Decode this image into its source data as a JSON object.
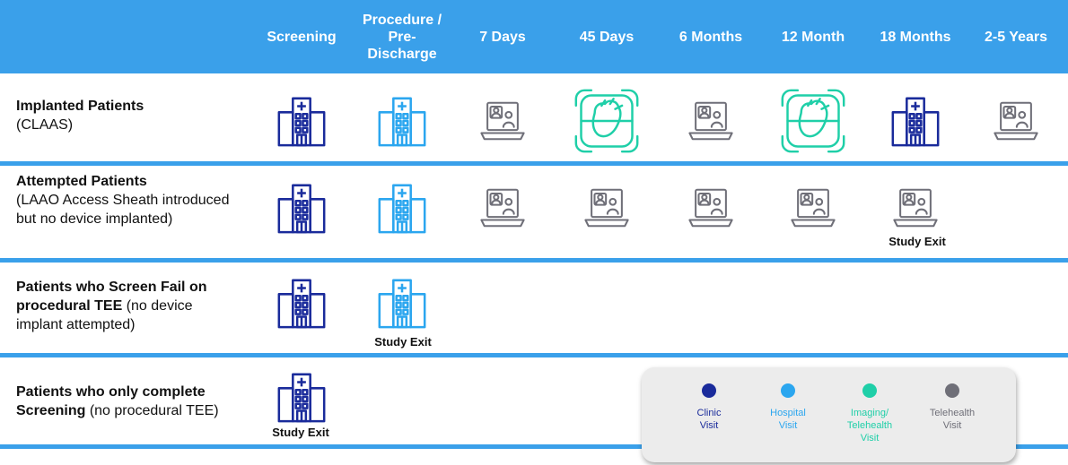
{
  "columns": [
    {
      "label": "Screening"
    },
    {
      "label": "Procedure /\nPre-\nDischarge"
    },
    {
      "label": "7 Days"
    },
    {
      "label": "45 Days"
    },
    {
      "label": "6 Months"
    },
    {
      "label": "12 Month"
    },
    {
      "label": "18 Months"
    },
    {
      "label": "2-5 Years"
    }
  ],
  "rows": [
    {
      "title": "Implanted Patients",
      "detail": "(CLAAS)",
      "visits": [
        "clinic",
        "hospital",
        "telehealth",
        "imaging",
        "telehealth",
        "imaging",
        "clinic",
        "telehealth"
      ]
    },
    {
      "title": "Attempted Patients",
      "detail": "(LAAO Access Sheath introduced but no device implanted)",
      "visits": [
        "clinic",
        "hospital",
        "telehealth",
        "telehealth",
        "telehealth",
        "telehealth",
        "telehealth",
        ""
      ]
    },
    {
      "title": "Patients who Screen Fail on procedural TEE",
      "detail": "(no device implant attempted)",
      "visits": [
        "clinic",
        "hospital",
        "",
        "",
        "",
        "",
        "",
        ""
      ]
    },
    {
      "title": "Patients who only complete Screening",
      "detail": "(no procedural TEE)",
      "visits": [
        "clinic",
        "",
        "",
        "",
        "",
        "",
        "",
        ""
      ]
    }
  ],
  "study_exit": "Study Exit",
  "legend": {
    "clinic": {
      "label": "Clinic Visit",
      "color": "#1a2b9b"
    },
    "hospital": {
      "label": "Hospital Visit",
      "color": "#2ba6ef"
    },
    "imaging": {
      "label": "Imaging/ Telehealth Visit",
      "color": "#1fcfa8"
    },
    "telehealth": {
      "label": "Telehealth Visit",
      "color": "#6f6f78"
    }
  },
  "icons": {
    "clinic": "hospital-building-icon",
    "hospital": "hospital-building-icon",
    "imaging": "heart-imaging-icon",
    "telehealth": "telehealth-laptop-icon"
  }
}
